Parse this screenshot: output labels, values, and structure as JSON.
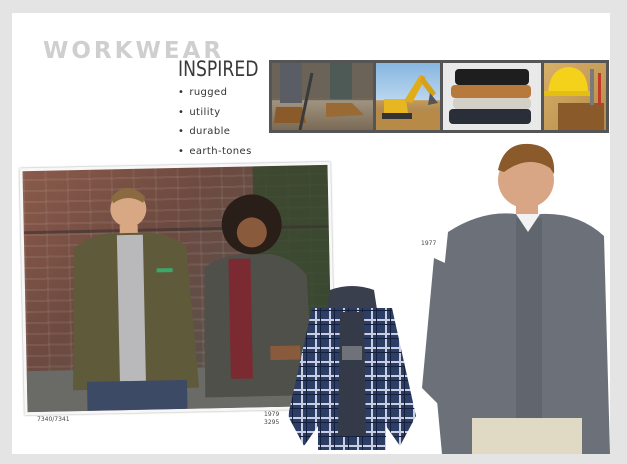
{
  "header": {
    "title_main": "WORKWEAR",
    "title_sub": "INSPIRED"
  },
  "bullets": [
    "rugged",
    "utility",
    "durable",
    "earth-tones"
  ],
  "photo_strip": [
    "boots-on-ground",
    "yellow-excavator",
    "folded-work-pants",
    "hard-hat-and-tool-belt"
  ],
  "captions": {
    "group": "7340/7341",
    "flannel_line1": "1979",
    "flannel_line2": "3295",
    "oxford": "1977"
  },
  "colors": {
    "title_light_gray": "#cfcfcf",
    "text_dark": "#333333",
    "olive_jacket": "#5f5a3a",
    "charcoal_jacket": "#4f504a",
    "navy_flannel": "#2c3d66",
    "gray_oxford": "#6b7079"
  }
}
